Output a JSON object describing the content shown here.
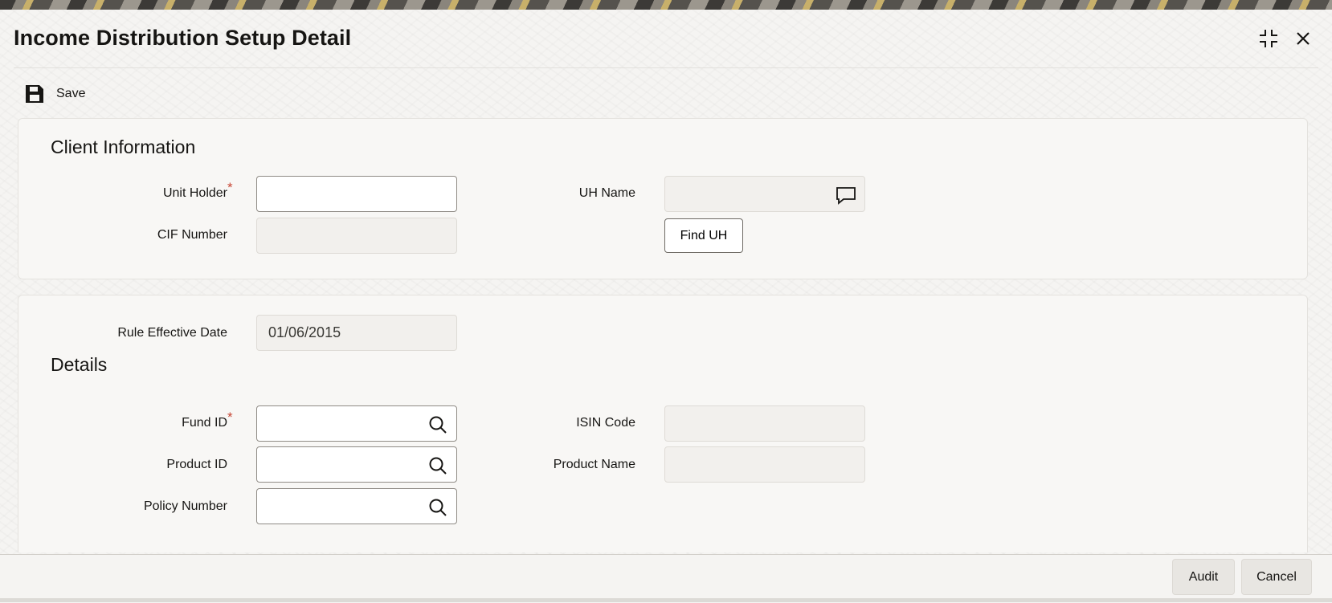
{
  "window": {
    "title": "Income Distribution Setup Detail",
    "controls": [
      "maximize-icon",
      "close-icon"
    ]
  },
  "toolbar": {
    "save_label": "Save",
    "save_icon": "save-disk-icon"
  },
  "client_information": {
    "heading": "Client Information",
    "unit_holder": {
      "label": "Unit Holder",
      "required": "*",
      "value": ""
    },
    "cif_number": {
      "label": "CIF Number",
      "value": ""
    },
    "uh_name": {
      "label": "UH Name",
      "value": "",
      "icon": "comment-icon"
    },
    "find_uh_label": "Find UH"
  },
  "rule": {
    "effective_date_label": "Rule Effective Date",
    "effective_date_value": "01/06/2015"
  },
  "details": {
    "heading": "Details",
    "fund_id": {
      "label": "Fund ID",
      "required": "*",
      "value": "",
      "icon": "search-icon"
    },
    "isin_code": {
      "label": "ISIN Code",
      "value": ""
    },
    "product_id": {
      "label": "Product ID",
      "value": "",
      "icon": "search-icon"
    },
    "product_name": {
      "label": "Product Name",
      "value": ""
    },
    "policy_number": {
      "label": "Policy Number",
      "value": "",
      "icon": "search-icon"
    }
  },
  "footer": {
    "audit_label": "Audit",
    "cancel_label": "Cancel"
  },
  "colors": {
    "required": "#c74634",
    "text": "#161513",
    "panel": "#f8f7f5"
  }
}
